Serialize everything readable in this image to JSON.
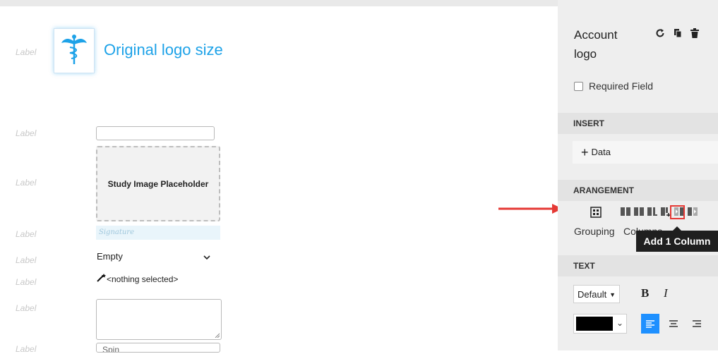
{
  "canvas": {
    "labels": [
      "Label",
      "Label",
      "Label",
      "Label",
      "Label",
      "Label",
      "Label",
      "Label"
    ],
    "logo_title": "Original logo size",
    "study_placeholder": "Study Image Placeholder",
    "signature_text": "Signature",
    "select_value": "Empty",
    "nothing_selected": "<nothing selected>",
    "spin_value": "Spin"
  },
  "panel": {
    "account_title": "Account logo",
    "required_label": "Required Field",
    "insert_header": "INSERT",
    "insert_data": "Data",
    "arrangement_header": "ARANGEMENT",
    "grouping_label": "Grouping",
    "columns_label": "Columns",
    "tooltip": "Add 1 Column",
    "text_header": "TEXT",
    "font_value": "Default",
    "bold_label": "B",
    "italic_label": "I",
    "text_color": "#000000"
  },
  "icons": [
    "refresh-icon",
    "copy-icon",
    "trash-icon",
    "grouping-icon",
    "column-icon",
    "add-column-icon",
    "text-color-icon",
    "align-left-icon",
    "align-center-icon",
    "align-right-icon"
  ],
  "colors": {
    "accent": "#1da2e8",
    "highlight": "#e53935",
    "active_align": "#1e90ff"
  }
}
